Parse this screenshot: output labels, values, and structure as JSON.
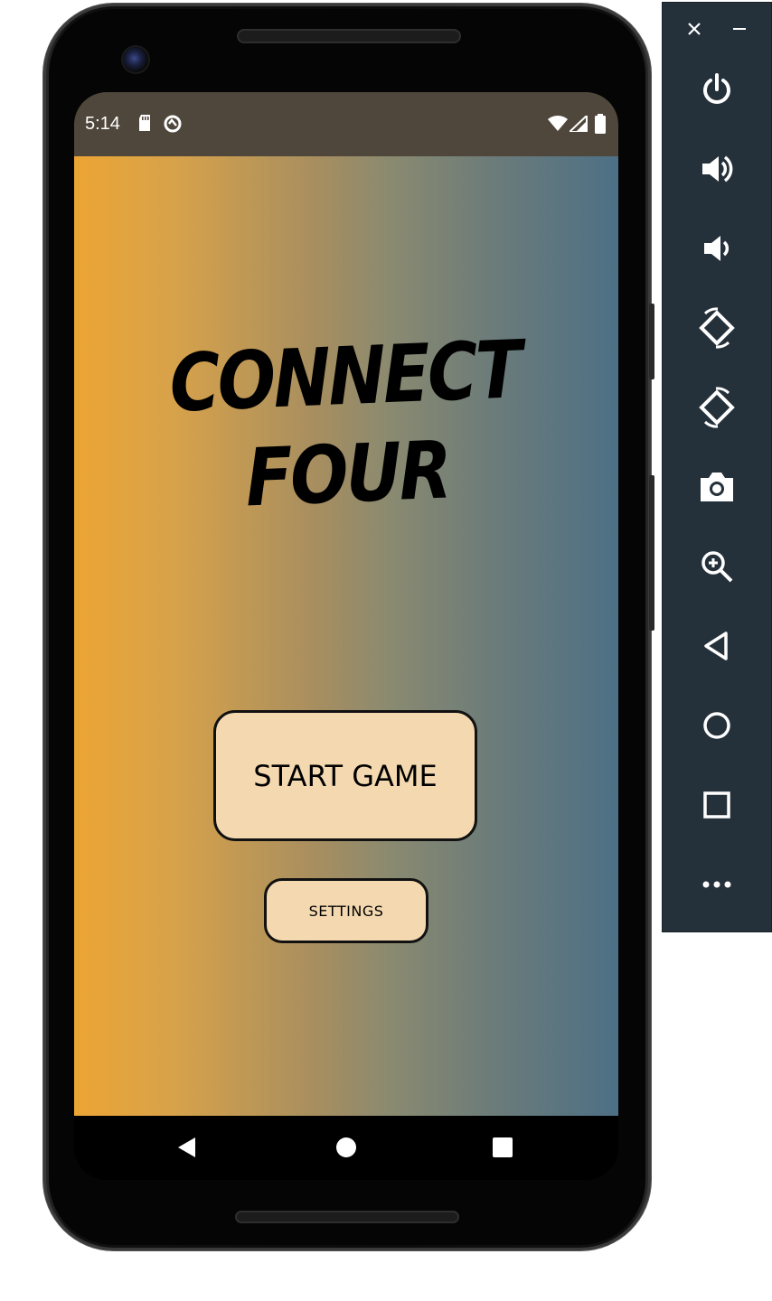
{
  "status_bar": {
    "time": "5:14"
  },
  "app": {
    "title_line1": "CONNECT",
    "title_line2": "FOUR",
    "start_button_label": "START GAME",
    "settings_button_label": "SETTINGS"
  },
  "colors": {
    "status_bar": "#4f473b",
    "gradient_left": "#eca534",
    "gradient_right": "#4d7086",
    "button_fill": "#f4d9b0",
    "toolbar_bg": "#25313a"
  },
  "icons": {
    "status": [
      "sd-card-icon",
      "data-saver-icon",
      "wifi-icon",
      "signal-icon",
      "battery-icon"
    ],
    "nav": [
      "back-icon",
      "home-icon",
      "recents-icon"
    ],
    "toolbar": [
      "close-icon",
      "minimize-icon",
      "power-icon",
      "volume-up-icon",
      "volume-down-icon",
      "rotate-left-icon",
      "rotate-right-icon",
      "camera-icon",
      "zoom-icon",
      "back-icon",
      "home-icon",
      "overview-icon",
      "more-icon"
    ]
  }
}
